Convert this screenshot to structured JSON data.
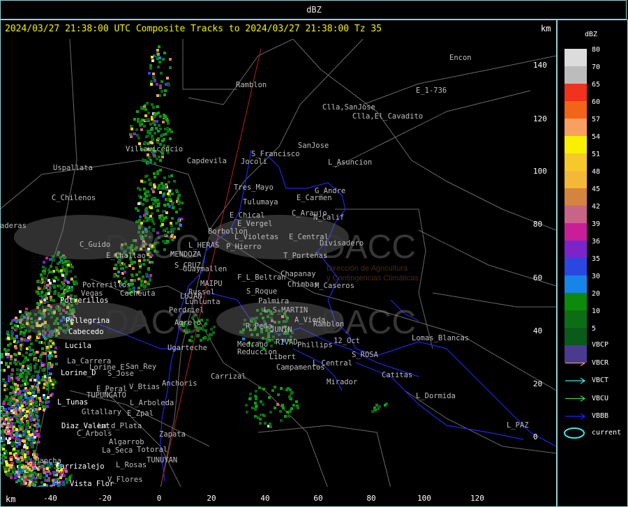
{
  "window": {
    "title": "dBZ"
  },
  "header": {
    "text": "2024/03/27 21:38:00 UTC Composite Tracks to 2024/03/27 21:38:00 Tz 35",
    "km_top": "km",
    "km_bottom": "km"
  },
  "axes": {
    "y_ticks": [
      "140",
      "120",
      "100",
      "80",
      "60",
      "40",
      "20",
      "0"
    ],
    "x_ticks": [
      "-40",
      "-20",
      "0",
      "20",
      "40",
      "60",
      "80",
      "100",
      "120"
    ],
    "units": "km"
  },
  "legend": {
    "title": "dBZ",
    "scale": [
      {
        "value": "80",
        "color": "#dcdcdc"
      },
      {
        "value": "70",
        "color": "#bcbcbc"
      },
      {
        "value": "65",
        "color": "#f0321e"
      },
      {
        "value": "60",
        "color": "#f26418"
      },
      {
        "value": "57",
        "color": "#f8a060"
      },
      {
        "value": "54",
        "color": "#f8f000"
      },
      {
        "value": "51",
        "color": "#f6c82c"
      },
      {
        "value": "48",
        "color": "#f4b838"
      },
      {
        "value": "45",
        "color": "#d4843c"
      },
      {
        "value": "42",
        "color": "#c86488"
      },
      {
        "value": "39",
        "color": "#c81e98"
      },
      {
        "value": "36",
        "color": "#7c24c8"
      },
      {
        "value": "35",
        "color": "#2848e0"
      },
      {
        "value": "30",
        "color": "#1684e8"
      },
      {
        "value": "20",
        "color": "#0c8a0c"
      },
      {
        "value": "10",
        "color": "#0c6e14"
      },
      {
        "value": "5",
        "color": "#0a5a1a"
      },
      {
        "value": "",
        "color": "#4a3a90"
      }
    ],
    "tracks": [
      {
        "label": "VBCP",
        "color": "#ffffff"
      },
      {
        "label": "VBCR",
        "color": "#f0a080"
      },
      {
        "label": "VBCT",
        "color": "#3fe8e8"
      },
      {
        "label": "VBCU",
        "color": "#3cd43c"
      },
      {
        "label": "VBBB",
        "color": "#2020ff"
      }
    ],
    "current_label": "current",
    "current_color": "#3fe8e8"
  },
  "watermark": {
    "brand": "DACC",
    "line1": "Dirección de Agricultura",
    "line2": "y Contingencias Climáticas"
  },
  "places_white": [
    "Potrerillos",
    "Pellegrina",
    "Cabecedo",
    "Lucila",
    "Lorine_D",
    "L_Tunas",
    "Diaz_Valent",
    "Carrizalejo",
    "Vista_Flor"
  ],
  "places_gray": [
    "Ramblon",
    "Encon",
    "E_1-736",
    "Clla,SanJose",
    "Clla,El_Cavadito",
    "SanJose",
    "S_Francisco",
    "Jocoli",
    "L_Asuncion",
    "Uspallata",
    "Villavicencio",
    "Capdevila",
    "Tres_Mayo",
    "G_Andre",
    "Tulumaya",
    "E_Carmen",
    "C_Chilenos",
    "E_Chical",
    "C_Araujo",
    "E_Vergel",
    "N_Calif",
    "Borbollon",
    "E_Central",
    "L_Violetas",
    "Divisadero",
    "C_Guido",
    "P_Hierro",
    "MENDOZA",
    "L_HERAS",
    "E_Challao",
    "T_Porteñas",
    "S_CRUZ",
    "Guaymallen",
    "Chapanay",
    "MAIPU",
    "F_L_Beltran",
    "Russel",
    "Chimbas",
    "M_Caseros",
    "Potrerillos",
    "S_Roque",
    "Vegas",
    "Cacheuta",
    "LUJAN",
    "Lunlunta",
    "Palmira",
    "Perdriel",
    "L_S_MARTIN",
    "Agrelo",
    "A_Vieda",
    "R_Peña",
    "JUNIN",
    "Ramblon",
    "Ugarteche",
    "RIVAD",
    "Phillips",
    "12_Oct",
    "Lomas_Blancas",
    "Medrano",
    "Reduccion",
    "Libert",
    "S_ROSA",
    "Campamentos",
    "L_Central",
    "Carrizal",
    "Anchoris",
    "Mirador",
    "Catitas",
    "E_Peral",
    "V_Btias",
    "TUPUNGATO",
    "L_Dormida",
    "L_Arboleda",
    "Gltallary",
    "E_Zpal",
    "L_PAZ",
    "La_d_Plata",
    "C_Arbols",
    "Zapata",
    "Algarrob",
    "La_Seca",
    "Totoral",
    "TUNUYAN",
    "Mancha",
    "L_Rosas",
    "V_Flores",
    "La_Carrera",
    "San_Rey",
    "S_Jose",
    "Lorine_E",
    "aderas"
  ]
}
